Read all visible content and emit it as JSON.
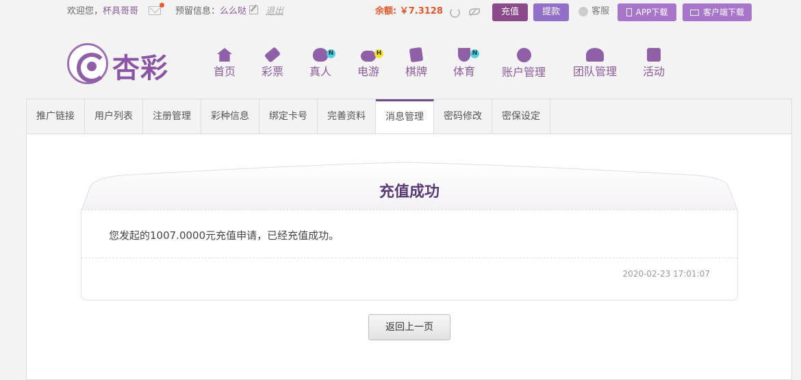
{
  "topbar": {
    "welcome": "欢迎您，",
    "username": "杯具哥哥",
    "reserved_label": "预留信息：",
    "reserved_value": "么么哒",
    "logout": "退出",
    "balance_label": "余额: ",
    "balance_value": "￥7.3128",
    "recharge": "充值",
    "withdraw": "提款",
    "service": "客服",
    "app_download": "APP下载",
    "client_download": "客户端下载",
    "colors": {
      "recharge": "#8a4a8c",
      "withdraw": "#9270c8",
      "download": "#a775c9",
      "balance": "#e0572a"
    }
  },
  "logo": {
    "text": "杏彩"
  },
  "nav": [
    {
      "label": "首页",
      "icon": "home-icon",
      "badge": ""
    },
    {
      "label": "彩票",
      "icon": "lottery-ticket-icon",
      "badge": ""
    },
    {
      "label": "真人",
      "icon": "live-dealer-icon",
      "badge": "N"
    },
    {
      "label": "电游",
      "icon": "gamepad-icon",
      "badge": "H"
    },
    {
      "label": "棋牌",
      "icon": "cards-icon",
      "badge": ""
    },
    {
      "label": "体育",
      "icon": "trophy-icon",
      "badge": "N"
    },
    {
      "label": "账户管理",
      "icon": "yen-coin-icon",
      "badge": ""
    },
    {
      "label": "团队管理",
      "icon": "team-icon",
      "badge": ""
    },
    {
      "label": "活动",
      "icon": "gift-icon",
      "badge": ""
    }
  ],
  "tabs": [
    {
      "label": "推广链接"
    },
    {
      "label": "用户列表"
    },
    {
      "label": "注册管理"
    },
    {
      "label": "彩种信息"
    },
    {
      "label": "绑定卡号"
    },
    {
      "label": "完善资料"
    },
    {
      "label": "消息管理",
      "active": true
    },
    {
      "label": "密码修改"
    },
    {
      "label": "密保设定"
    }
  ],
  "message": {
    "title": "充值成功",
    "body": "您发起的1007.0000元充值申请，已经充值成功。",
    "timestamp": "2020-02-23 17:01:07"
  },
  "back_button": "返回上一页"
}
